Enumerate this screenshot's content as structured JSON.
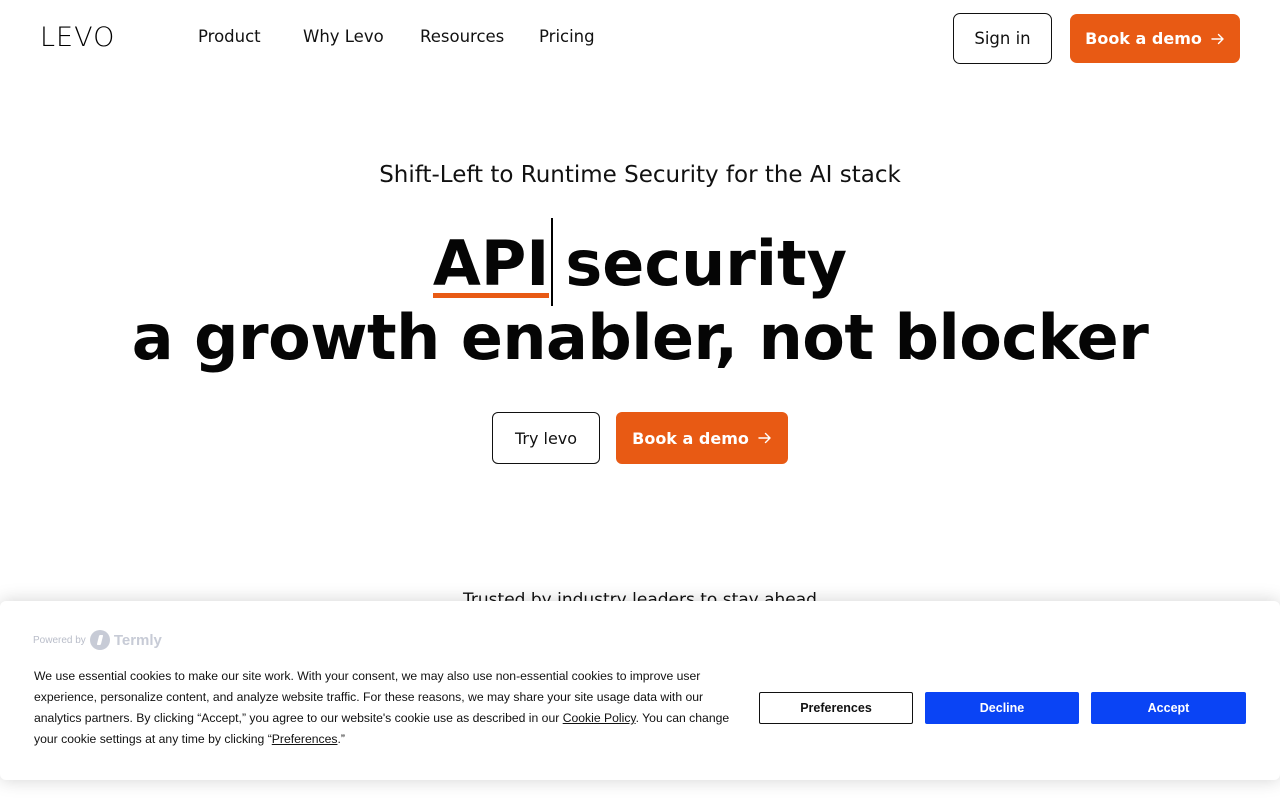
{
  "header": {
    "logo": "LEVO",
    "nav": [
      "Product",
      "Why Levo",
      "Resources",
      "Pricing"
    ],
    "sign_in": "Sign in",
    "book_demo": "Book a demo"
  },
  "hero": {
    "eyebrow": "Shift-Left to Runtime Security for the AI stack",
    "headline_highlight": "API",
    "headline_line1_rest": "security",
    "headline_line2": "a growth enabler, not blocker",
    "try_button": "Try levo",
    "demo_button": "Book a demo"
  },
  "trusted": "Trusted by industry leaders to stay ahead",
  "cookie": {
    "powered_by": "Powered by",
    "brand": "Termly",
    "text_part1": "We use essential cookies to make our site work. With your consent, we may also use non-essential cookies to improve user experience, personalize content, and analyze website traffic. For these reasons, we may share your site usage data with our analytics partners. By clicking “Accept,” you agree to our website's cookie use as described in our ",
    "cookie_policy_link": "Cookie Policy",
    "text_part2": ". You can change your cookie settings at any time by clicking “",
    "preferences_link": "Preferences",
    "text_part3": ".”",
    "preferences_button": "Preferences",
    "decline_button": "Decline",
    "accept_button": "Accept"
  },
  "colors": {
    "accent_orange": "#e85a14",
    "cookie_blue": "#0a44f5"
  }
}
